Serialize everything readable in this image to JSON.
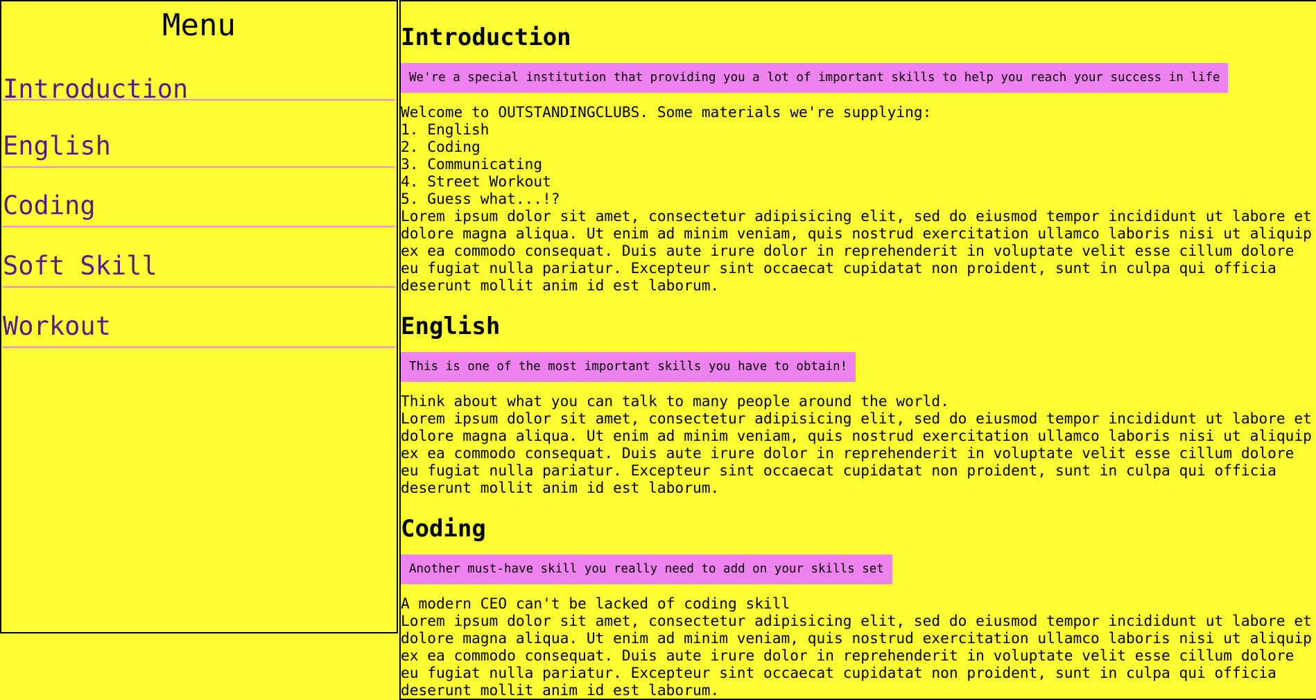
{
  "sidebar": {
    "title": "Menu",
    "items": [
      {
        "label": "Introduction"
      },
      {
        "label": "English"
      },
      {
        "label": "Coding"
      },
      {
        "label": "Soft Skill"
      },
      {
        "label": "Workout"
      }
    ]
  },
  "main": {
    "sections": [
      {
        "heading": "Introduction",
        "callout": "We're a special institution that providing you a lot of important skills to help you reach your success in life",
        "lines": [
          "Welcome to OUTSTANDINGCLUBS. Some materials we're supplying:",
          "1. English",
          "2. Coding",
          "3. Communicating",
          "4. Street Workout",
          "5. Guess what...!?"
        ],
        "lorem": "Lorem ipsum dolor sit amet, consectetur adipisicing elit, sed do eiusmod tempor incididunt ut labore et dolore magna aliqua. Ut enim ad minim veniam, quis nostrud exercitation ullamco laboris nisi ut aliquip ex ea commodo consequat. Duis aute irure dolor in reprehenderit in voluptate velit esse cillum dolore eu fugiat nulla pariatur. Excepteur sint occaecat cupidatat non proident, sunt in culpa qui officia deserunt mollit anim id est laborum."
      },
      {
        "heading": "English",
        "callout": "This is one of the most important skills you have to obtain!",
        "lines": [
          "Think about what you can talk to many people around the world."
        ],
        "lorem": "Lorem ipsum dolor sit amet, consectetur adipisicing elit, sed do eiusmod tempor incididunt ut labore et dolore magna aliqua. Ut enim ad minim veniam, quis nostrud exercitation ullamco laboris nisi ut aliquip ex ea commodo consequat. Duis aute irure dolor in reprehenderit in voluptate velit esse cillum dolore eu fugiat nulla pariatur. Excepteur sint occaecat cupidatat non proident, sunt in culpa qui officia deserunt mollit anim id est laborum."
      },
      {
        "heading": "Coding",
        "callout": "Another must-have skill you really need to add on your skills set",
        "lines": [
          "A modern CEO can't be lacked of coding skill"
        ],
        "lorem": "Lorem ipsum dolor sit amet, consectetur adipisicing elit, sed do eiusmod tempor incididunt ut labore et dolore magna aliqua. Ut enim ad minim veniam, quis nostrud exercitation ullamco laboris nisi ut aliquip ex ea commodo consequat. Duis aute irure dolor in reprehenderit in voluptate velit esse cillum dolore eu fugiat nulla pariatur. Excepteur sint occaecat cupidatat non proident, sunt in culpa qui officia deserunt mollit anim id est laborum."
      }
    ]
  },
  "colors": {
    "background": "#ffff33",
    "callout": "#ee82ee",
    "link": "#551a8b",
    "divider": "#ee82ee"
  }
}
